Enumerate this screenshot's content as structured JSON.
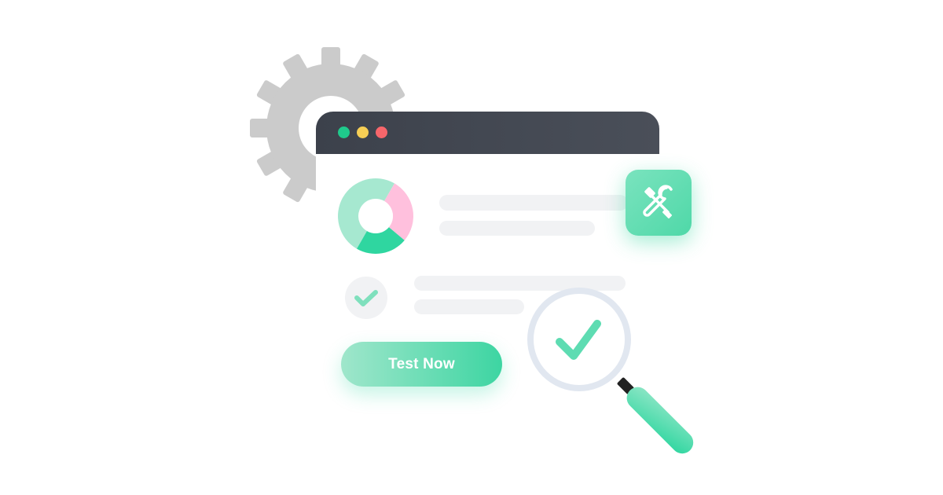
{
  "cta": {
    "label": "Test Now"
  },
  "window_controls": [
    {
      "name": "green-dot",
      "color": "#1fca8c"
    },
    {
      "name": "yellow-dot",
      "color": "#f6ce55"
    },
    {
      "name": "red-dot",
      "color": "#f7666b"
    }
  ],
  "icons": {
    "gear": "gear-icon",
    "donut": "donut-chart-icon",
    "check": "check-icon",
    "tools": "wrench-screwdriver-icon",
    "magnifier": "magnifier-check-icon"
  },
  "colors": {
    "accent": "#3dd5a2",
    "accent_light": "#a6e8d0",
    "pink": "#ffc0dd",
    "gear": "#cbcbcb",
    "titlebar": "#434852",
    "skeleton": "#f1f2f4",
    "lens_ring": "#e1e7f0"
  }
}
